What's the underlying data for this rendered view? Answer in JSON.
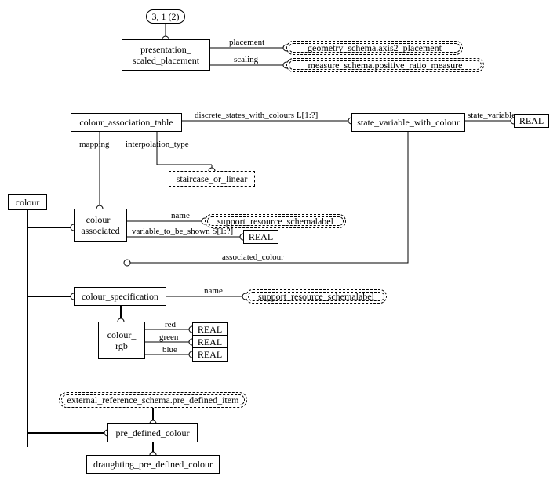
{
  "page_ref": "3, 1 (2)",
  "entities": {
    "presentation_scaled_placement": "presentation_\nscaled_placement",
    "geometry_axis2": "geometry_schema.axis2_placement",
    "measure_positive_ratio": "measure_schema.positive_ratio_measure",
    "colour_association_table": "colour_association_table",
    "state_variable_with_colour": "state_variable_with_colour",
    "real": "REAL",
    "staircase_or_linear": "staircase_or_linear",
    "colour": "colour",
    "colour_associated": "colour_\nassociated",
    "support_resource_schemalabel": "support_resource_schemalabel",
    "colour_specification": "colour_specification",
    "colour_rgb": "colour_\nrgb",
    "external_ref_pre_defined_item": "external_reference_schema.pre_defined_item",
    "pre_defined_colour": "pre_defined_colour",
    "draughting_pre_defined_colour": "draughting_pre_defined_colour"
  },
  "labels": {
    "placement": "placement",
    "scaling": "scaling",
    "discrete_states_with_colours": "discrete_states_with_colours L[1:?]",
    "state_variable": "state_variable",
    "mapping": "mapping",
    "interpolation_type": "interpolation_type",
    "name": "name",
    "variable_to_be_shown": "variable_to_be_shown S[1:?]",
    "associated_colour": "associated_colour",
    "red": "red",
    "green": "green",
    "blue": "blue"
  }
}
